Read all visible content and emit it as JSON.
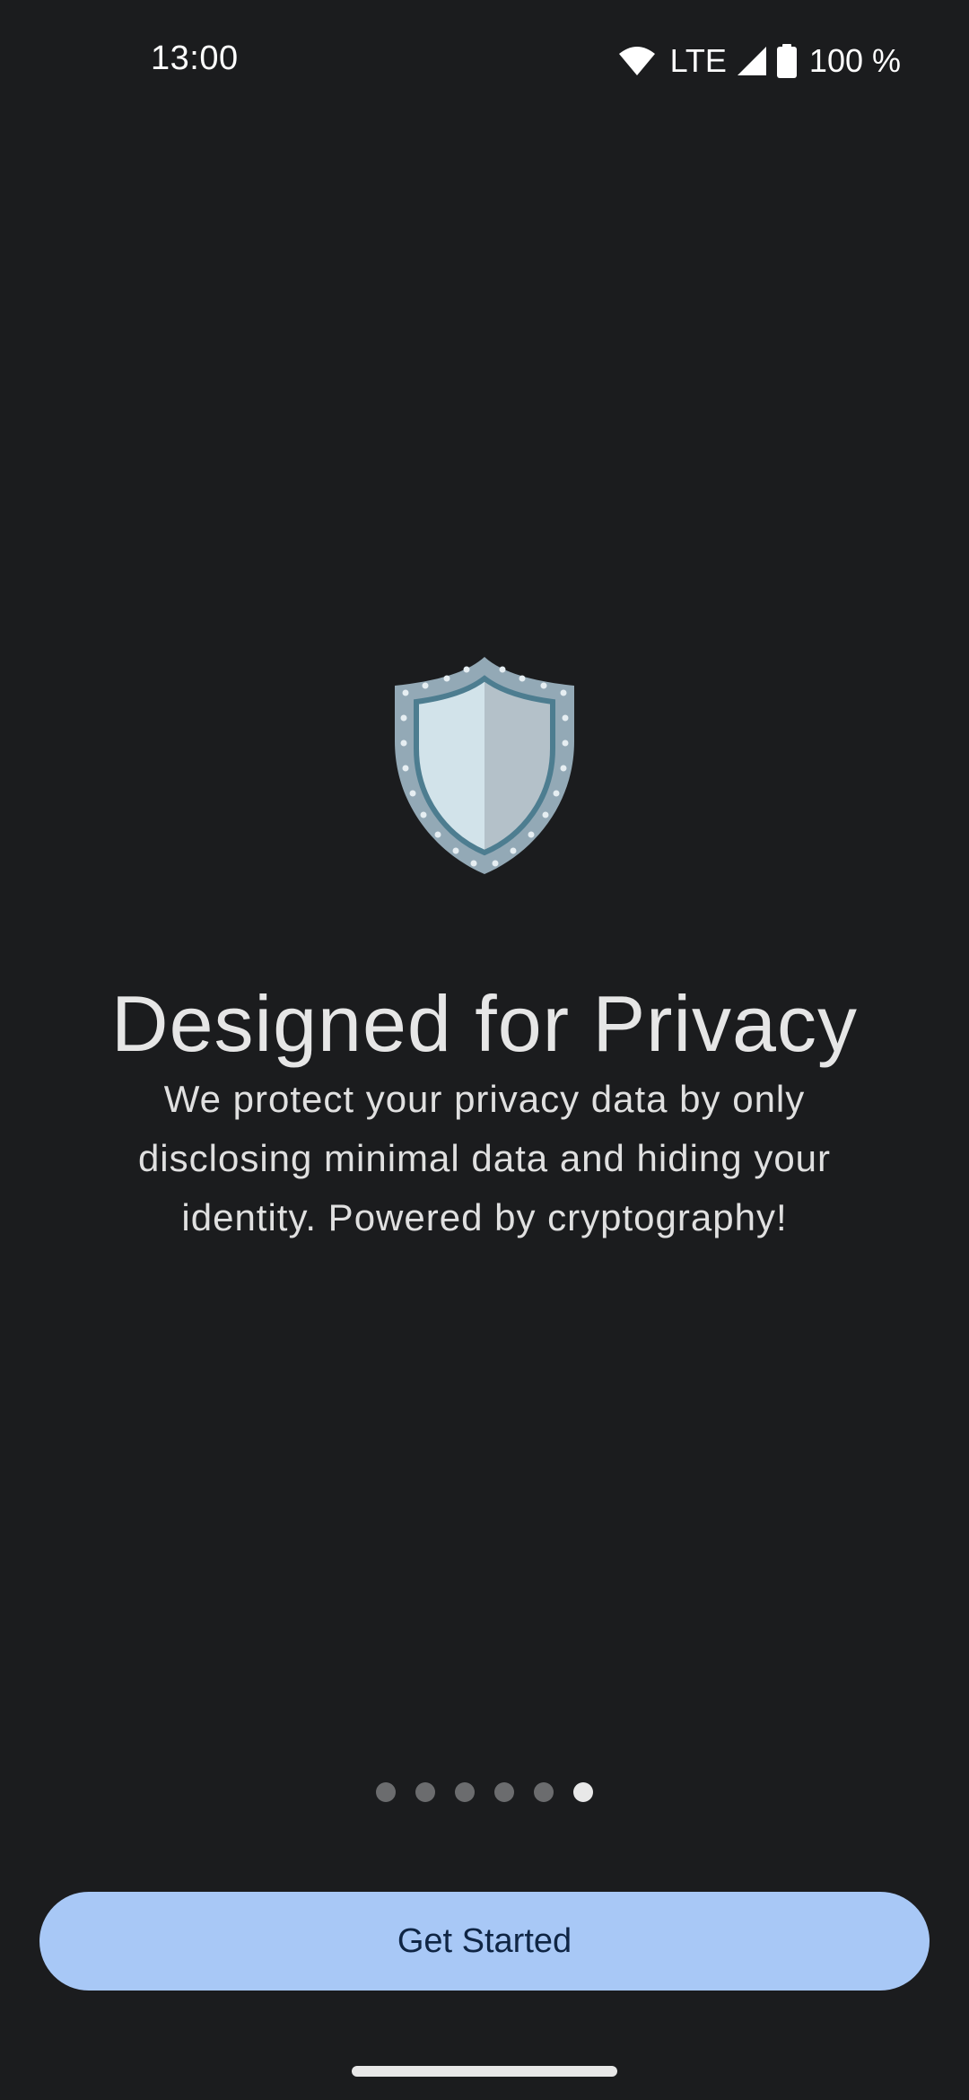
{
  "status_bar": {
    "time": "13:00",
    "network": "LTE",
    "battery": "100 %",
    "icons": [
      "wifi-icon",
      "signal-icon",
      "battery-icon"
    ]
  },
  "onboarding": {
    "hero_icon": "shield-icon",
    "title": "Designed for Privacy",
    "description": "We protect your privacy data by only disclosing minimal data and hiding your identity. Powered by cryptography!",
    "page_count": 6,
    "active_page_index": 5
  },
  "actions": {
    "primary_label": "Get Started"
  },
  "colors": {
    "background": "#1b1c1e",
    "button": "#a8c8f6",
    "button_text": "#0f2544",
    "dot_inactive": "#6b6c6e",
    "dot_active": "#e8e8e8"
  }
}
